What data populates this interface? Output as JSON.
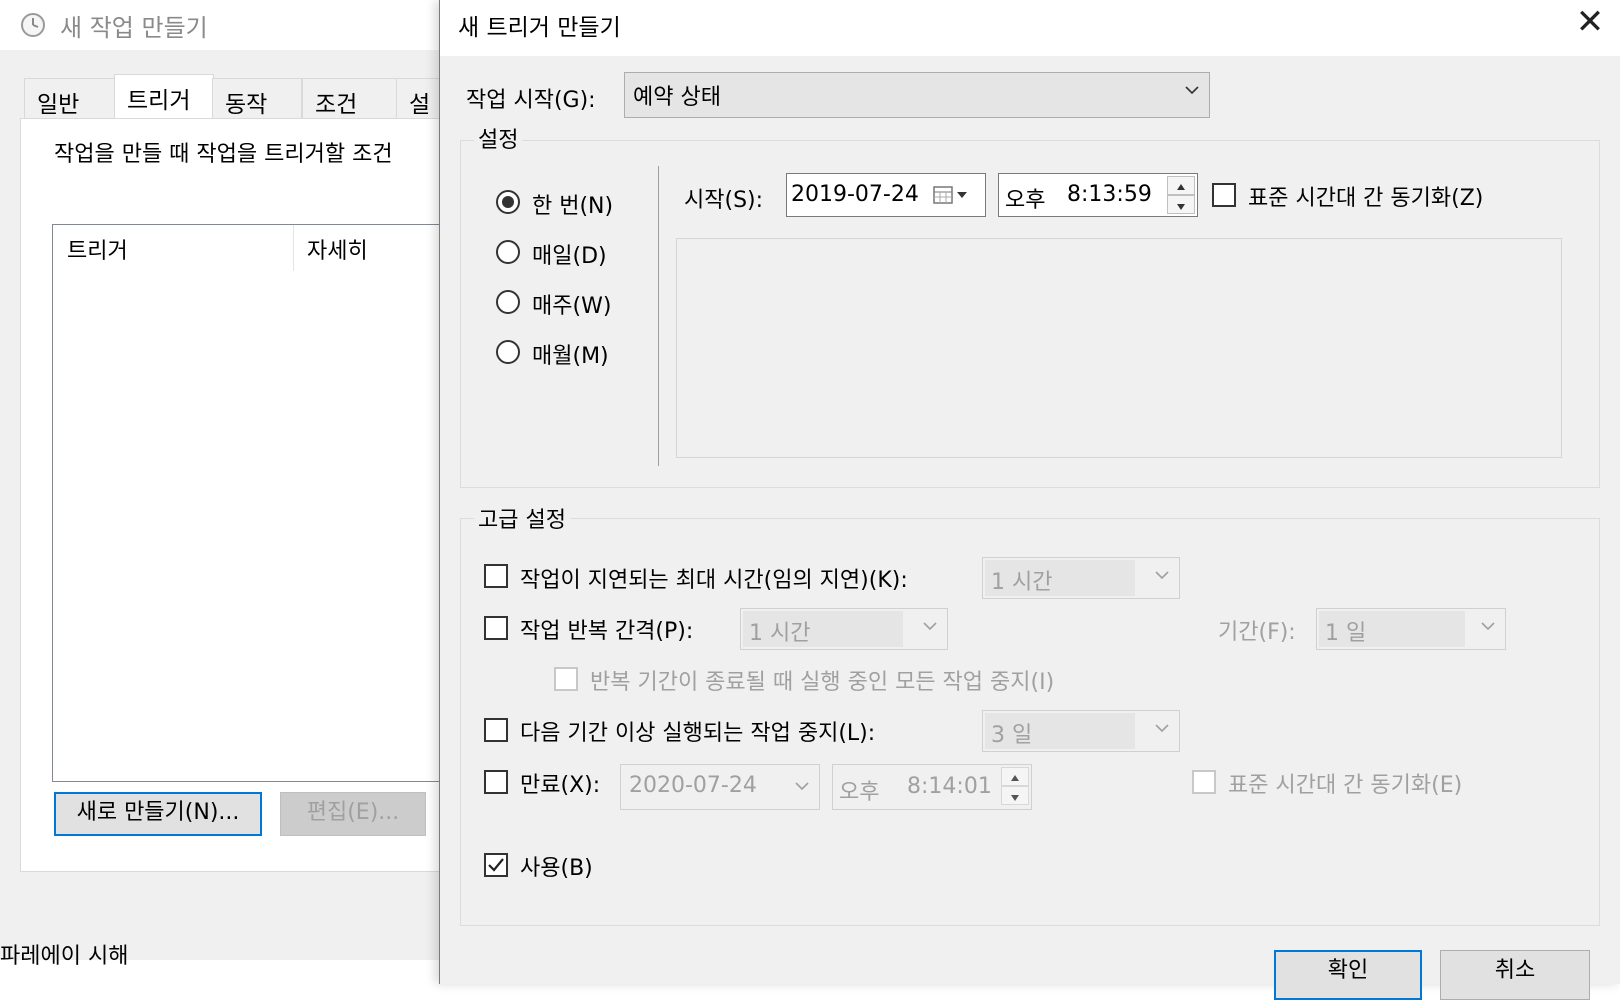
{
  "bg_window": {
    "title": "새 작업 만들기",
    "tabs": [
      "일반",
      "트리거",
      "동작",
      "조건",
      "설"
    ],
    "description": "작업을 만들 때 작업을 트리거할 조건",
    "list_columns": [
      "트리거",
      "자세히"
    ],
    "new_button": "새로 만들기(N)...",
    "edit_button": "편집(E)...",
    "bottom_text": "파레에이 시해"
  },
  "dialog": {
    "title": "새 트리거 만들기",
    "close_glyph": "✕",
    "begin_task_label": "작업 시작(G):",
    "begin_task_value": "예약 상태",
    "settings_group": "설정",
    "schedule_options": [
      "한 번(N)",
      "매일(D)",
      "매주(W)",
      "매월(M)"
    ],
    "selected_schedule": "한 번(N)",
    "start_label": "시작(S):",
    "start_date": "2019-07-24",
    "start_ampm": "오후",
    "start_time": "8:13:59",
    "sync_tz_label": "표준 시간대 간 동기화(Z)",
    "advanced_group": "고급 설정",
    "delay_label": "작업이 지연되는 최대 시간(임의 지연)(K):",
    "delay_value": "1 시간",
    "repeat_label": "작업 반복 간격(P):",
    "repeat_value": "1 시간",
    "duration_label": "기간(F):",
    "duration_value": "1 일",
    "stop_repeat_label": "반복 기간이 종료될 때 실행 중인 모든 작업 중지(I)",
    "stop_longer_label": "다음 기간 이상 실행되는 작업 중지(L):",
    "stop_longer_value": "3 일",
    "expire_label": "만료(X):",
    "expire_date": "2020-07-24",
    "expire_ampm": "오후",
    "expire_time": "8:14:01",
    "expire_sync_label": "표준 시간대 간 동기화(E)",
    "enabled_label": "사용(B)",
    "ok_button": "확인",
    "cancel_button": "취소"
  },
  "colors": {
    "accent": "#0078d7",
    "dialog_bg": "#f0f0f0",
    "disabled_text": "#a0a0a0"
  }
}
